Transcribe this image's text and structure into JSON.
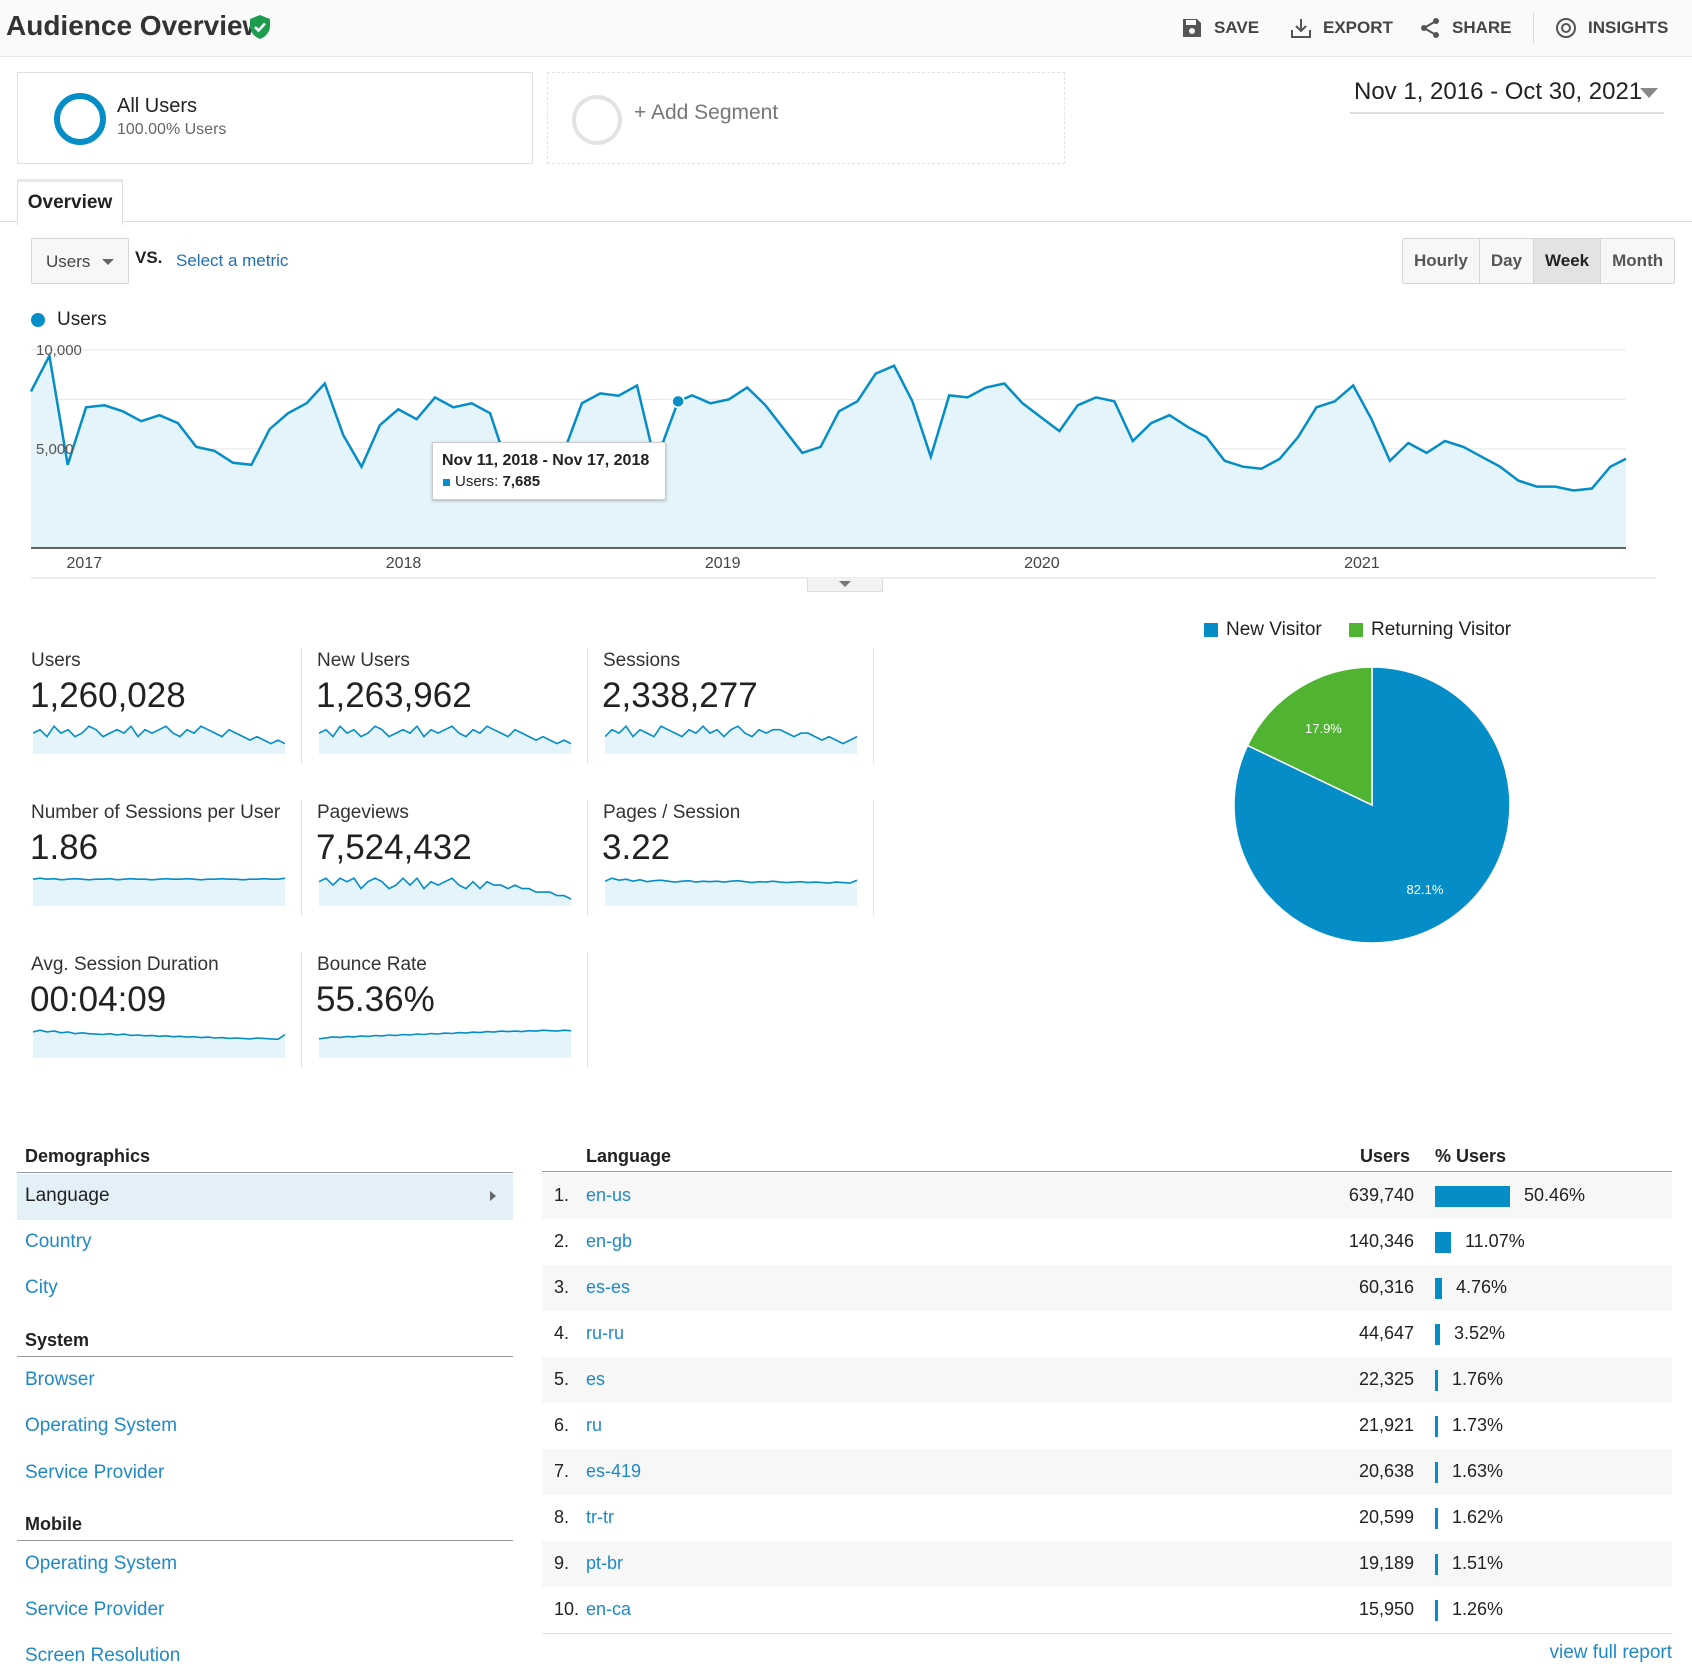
{
  "header": {
    "title": "Audience Overview",
    "save": "SAVE",
    "export": "EXPORT",
    "share": "SHARE",
    "insights": "INSIGHTS"
  },
  "segments": {
    "all_name": "All Users",
    "all_sub": "100.00% Users",
    "add": "+ Add Segment"
  },
  "date_range": "Nov 1, 2016 - Oct 30, 2021",
  "tab": "Overview",
  "controls": {
    "metric": "Users",
    "vs": "VS.",
    "select_metric": "Select a metric",
    "granularity": [
      "Hourly",
      "Day",
      "Week",
      "Month"
    ],
    "active_granularity": "Week"
  },
  "colors": {
    "primary": "#058dc7",
    "returning": "#50b432",
    "link": "#1f89c8"
  },
  "chart_data": [
    {
      "type": "area",
      "legend": [
        "Users"
      ],
      "y_ticks": [
        "10,000",
        "5,000"
      ],
      "ylim": [
        0,
        11000
      ],
      "x_ticks": [
        "2017",
        "2018",
        "2019",
        "2020",
        "2021"
      ],
      "xlim": [
        "2016-11-01",
        "2021-10-30"
      ],
      "series": [
        {
          "name": "Users",
          "x": [
            "2016-11-01",
            "2016-11-22",
            "2016-12-13",
            "2017-01-03",
            "2017-01-24",
            "2017-02-14",
            "2017-03-07",
            "2017-03-28",
            "2017-04-18",
            "2017-05-09",
            "2017-05-30",
            "2017-06-20",
            "2017-07-11",
            "2017-08-01",
            "2017-08-22",
            "2017-09-12",
            "2017-10-03",
            "2017-10-24",
            "2017-11-14",
            "2017-12-05",
            "2017-12-26",
            "2018-01-16",
            "2018-02-06",
            "2018-02-27",
            "2018-03-20",
            "2018-04-10",
            "2018-05-01",
            "2018-05-22",
            "2018-06-12",
            "2018-07-03",
            "2018-07-24",
            "2018-08-14",
            "2018-09-04",
            "2018-09-25",
            "2018-10-16",
            "2018-11-11",
            "2018-11-27",
            "2018-12-18",
            "2019-01-08",
            "2019-01-29",
            "2019-02-19",
            "2019-03-12",
            "2019-04-02",
            "2019-04-23",
            "2019-05-14",
            "2019-06-04",
            "2019-06-25",
            "2019-07-16",
            "2019-08-06",
            "2019-08-27",
            "2019-09-17",
            "2019-10-08",
            "2019-10-29",
            "2019-11-19",
            "2019-12-10",
            "2019-12-31",
            "2020-01-21",
            "2020-02-11",
            "2020-03-03",
            "2020-03-24",
            "2020-04-14",
            "2020-05-05",
            "2020-05-26",
            "2020-06-16",
            "2020-07-07",
            "2020-07-28",
            "2020-08-18",
            "2020-09-08",
            "2020-09-29",
            "2020-10-20",
            "2020-11-10",
            "2020-12-01",
            "2020-12-22",
            "2021-01-12",
            "2021-02-02",
            "2021-02-23",
            "2021-03-16",
            "2021-04-06",
            "2021-04-27",
            "2021-05-18",
            "2021-06-08",
            "2021-06-29",
            "2021-07-20",
            "2021-08-10",
            "2021-08-31",
            "2021-09-21",
            "2021-10-12",
            "2021-10-30"
          ],
          "values": [
            7900,
            9700,
            4200,
            7100,
            7200,
            6900,
            6400,
            6700,
            6300,
            5100,
            4900,
            4300,
            4200,
            6000,
            6800,
            7300,
            8300,
            5700,
            4100,
            6200,
            7000,
            6500,
            7600,
            7100,
            7300,
            6800,
            4000,
            5000,
            4600,
            4800,
            7300,
            7800,
            7685,
            8200,
            4300,
            7400,
            7700,
            7300,
            7500,
            8100,
            7200,
            6000,
            4800,
            5100,
            6900,
            7400,
            8800,
            9200,
            7400,
            4600,
            7700,
            7600,
            8100,
            8300,
            7300,
            6600,
            5900,
            7200,
            7600,
            7400,
            5400,
            6300,
            6700,
            6100,
            5600,
            4400,
            4100,
            4000,
            4500,
            5600,
            7100,
            7400,
            8200,
            6500,
            4400,
            5300,
            4800,
            5400,
            5100,
            4600,
            4100,
            3400,
            3100,
            3100,
            2900,
            3000,
            4100,
            4500
          ]
        }
      ]
    },
    {
      "type": "pie",
      "legend": [
        "New Visitor",
        "Returning Visitor"
      ],
      "labels": [
        "82.1%",
        "17.9%"
      ],
      "values": [
        82.1,
        17.9
      ]
    }
  ],
  "tooltip": {
    "date": "Nov 11, 2018 - Nov 17, 2018",
    "label": "Users: ",
    "value": "7,685"
  },
  "kpis": [
    {
      "label": "Users",
      "value": "1,260,028",
      "trend": [
        6,
        7,
        5,
        8,
        6,
        7,
        5,
        6,
        8,
        7,
        5,
        6,
        7,
        6,
        8,
        5,
        7,
        6,
        7,
        8,
        6,
        5,
        7,
        6,
        8,
        7,
        6,
        5,
        7,
        6,
        5,
        4,
        5,
        4,
        3,
        4,
        3
      ]
    },
    {
      "label": "New Users",
      "value": "1,263,962",
      "trend": [
        6,
        7,
        5,
        8,
        6,
        7,
        5,
        6,
        8,
        7,
        5,
        6,
        7,
        6,
        8,
        5,
        7,
        6,
        7,
        8,
        6,
        5,
        7,
        6,
        8,
        7,
        6,
        5,
        7,
        6,
        5,
        4,
        5,
        4,
        3,
        4,
        3
      ]
    },
    {
      "label": "Sessions",
      "value": "2,338,277",
      "trend": [
        5,
        7,
        6,
        8,
        5,
        7,
        6,
        5,
        8,
        7,
        6,
        5,
        7,
        6,
        8,
        6,
        7,
        5,
        7,
        8,
        6,
        5,
        7,
        6,
        7,
        7,
        6,
        5,
        6,
        6,
        5,
        4,
        5,
        4,
        3,
        4,
        5
      ]
    },
    {
      "label": "Number of Sessions per User",
      "value": "1.86",
      "trend": [
        5,
        5.2,
        5,
        5.1,
        4.9,
        5,
        5.1,
        5,
        4.9,
        5,
        5,
        5.1,
        4.9,
        5,
        5.1,
        5,
        5,
        4.9,
        5,
        5.1,
        5,
        5,
        5.1,
        5,
        4.9,
        5,
        5,
        5.1,
        5,
        5,
        4.9,
        5,
        5,
        5.1,
        5,
        5,
        5.2
      ]
    },
    {
      "label": "Pageviews",
      "value": "7,524,432",
      "trend": [
        7,
        8,
        6,
        8,
        7,
        8,
        5,
        7,
        8,
        7,
        5,
        6,
        8,
        6,
        8,
        5,
        7,
        6,
        7,
        8,
        6,
        5,
        7,
        5,
        7,
        6,
        6,
        5,
        6,
        5,
        5,
        4,
        4,
        4,
        3,
        3,
        2
      ]
    },
    {
      "label": "Pages / Session",
      "value": "3.22",
      "trend": [
        5,
        5.6,
        5.2,
        5.4,
        5,
        5.3,
        4.9,
        5.1,
        5.2,
        5,
        4.8,
        5,
        5.1,
        4.8,
        5,
        4.9,
        5,
        4.8,
        5,
        5.1,
        4.9,
        4.7,
        4.9,
        4.8,
        5,
        4.8,
        4.7,
        4.8,
        4.9,
        4.7,
        4.8,
        4.7,
        4.6,
        4.8,
        4.7,
        4.6,
        5.2
      ]
    },
    {
      "label": "Avg. Session Duration",
      "value": "00:04:09",
      "trend": [
        6,
        6.4,
        6,
        6.2,
        5.8,
        6,
        5.6,
        5.8,
        5.6,
        5.5,
        5.4,
        5.6,
        5.3,
        5.5,
        5.2,
        5.3,
        5.1,
        5.2,
        5,
        5.1,
        4.9,
        5,
        4.8,
        4.9,
        4.7,
        4.8,
        4.6,
        4.7,
        4.5,
        4.6,
        4.5,
        4.4,
        4.6,
        4.5,
        4.4,
        4.3,
        5.4
      ]
    },
    {
      "label": "Bounce Rate",
      "value": "55.36%",
      "trend": [
        4,
        4.2,
        4.4,
        4.3,
        4.5,
        4.4,
        4.6,
        4.5,
        4.7,
        4.6,
        4.8,
        4.7,
        4.9,
        4.8,
        5,
        4.9,
        5.1,
        5,
        5.2,
        5.1,
        5.3,
        5.2,
        5.4,
        5.3,
        5.5,
        5.4,
        5.6,
        5.5,
        5.6,
        5.5,
        5.7,
        5.6,
        5.8,
        5.7,
        5.6,
        5.8,
        5.7
      ]
    }
  ],
  "demographics": {
    "header": "Demographics",
    "language": "Language",
    "country": "Country",
    "city": "City",
    "system_header": "System",
    "browser": "Browser",
    "os": "Operating System",
    "provider": "Service Provider",
    "mobile_header": "Mobile",
    "mobile_os": "Operating System",
    "mobile_provider": "Service Provider",
    "resolution": "Screen Resolution"
  },
  "table": {
    "col_language": "Language",
    "col_users": "Users",
    "col_pct": "% Users",
    "rows": [
      {
        "n": "1.",
        "lang": "en-us",
        "users": "639,740",
        "pct": "50.46%",
        "frac": 0.5046
      },
      {
        "n": "2.",
        "lang": "en-gb",
        "users": "140,346",
        "pct": "11.07%",
        "frac": 0.1107
      },
      {
        "n": "3.",
        "lang": "es-es",
        "users": "60,316",
        "pct": "4.76%",
        "frac": 0.0476
      },
      {
        "n": "4.",
        "lang": "ru-ru",
        "users": "44,647",
        "pct": "3.52%",
        "frac": 0.0352
      },
      {
        "n": "5.",
        "lang": "es",
        "users": "22,325",
        "pct": "1.76%",
        "frac": 0.0176
      },
      {
        "n": "6.",
        "lang": "ru",
        "users": "21,921",
        "pct": "1.73%",
        "frac": 0.0173
      },
      {
        "n": "7.",
        "lang": "es-419",
        "users": "20,638",
        "pct": "1.63%",
        "frac": 0.0163
      },
      {
        "n": "8.",
        "lang": "tr-tr",
        "users": "20,599",
        "pct": "1.62%",
        "frac": 0.0162
      },
      {
        "n": "9.",
        "lang": "pt-br",
        "users": "19,189",
        "pct": "1.51%",
        "frac": 0.0151
      },
      {
        "n": "10.",
        "lang": "en-ca",
        "users": "15,950",
        "pct": "1.26%",
        "frac": 0.0126
      }
    ],
    "view_full": "view full report"
  }
}
